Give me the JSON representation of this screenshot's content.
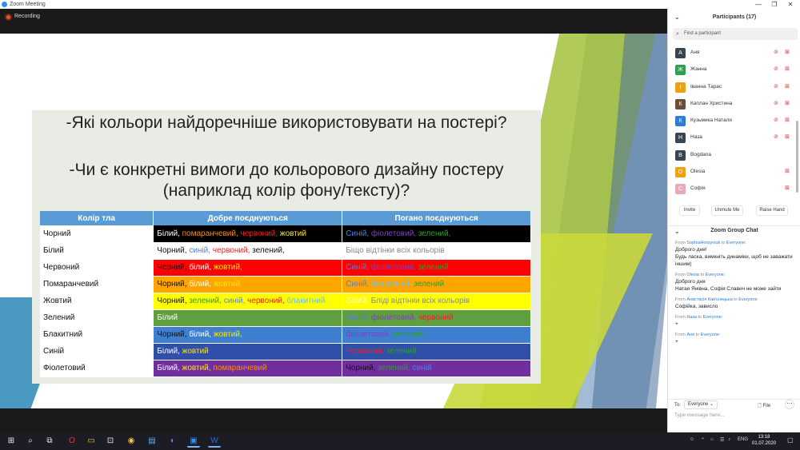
{
  "window": {
    "title": "Zoom Meeting"
  },
  "recording": {
    "label": "Recording"
  },
  "slide": {
    "question1": "-Які кольори найдоречніше використовувати на постері?",
    "question2_line1": "-Чи є конкретні вимоги до кольорового дизайну постеру",
    "question2_line2": "(наприклад колір фону/тексту)?",
    "table": {
      "headers": [
        "Колір тла",
        "Добре поєднуються",
        "Погано поєднуються"
      ],
      "rows": [
        {
          "name": "Чорний",
          "good_bg": "#000000",
          "bad_bg": "#000000",
          "good": [
            [
              "Білий, ",
              "white"
            ],
            [
              "помаранчевий, ",
              "orange"
            ],
            [
              "червоний, ",
              "red"
            ],
            [
              "жовтий",
              "yellow"
            ]
          ],
          "bad": [
            [
              "Синій, ",
              "blue"
            ],
            [
              "фіолетовий, ",
              "violet"
            ],
            [
              "зелений,",
              "green"
            ]
          ]
        },
        {
          "name": "Білий",
          "good_bg": "#ffffff",
          "bad_bg": "#ffffff",
          "good": [
            [
              "Чорний, ",
              "black"
            ],
            [
              "синій, ",
              "blue"
            ],
            [
              "червоний, ",
              "red"
            ],
            [
              "зелений,",
              "black"
            ]
          ],
          "bad": [
            [
              "Біщо відтінки всіх кольорів",
              "pale"
            ]
          ]
        },
        {
          "name": "Червоний",
          "good_bg": "#ff0000",
          "bad_bg": "#ff0000",
          "good": [
            [
              "Чорний, ",
              "black"
            ],
            [
              "білий, ",
              "white"
            ],
            [
              "жовтий,",
              "yellow"
            ]
          ],
          "bad": [
            [
              "Синій, ",
              "blue"
            ],
            [
              "фіолетовий, ",
              "violet"
            ],
            [
              "зелений",
              "green"
            ]
          ]
        },
        {
          "name": "Помаранчевий",
          "good_bg": "#ffa500",
          "bad_bg": "#ffa500",
          "good": [
            [
              "Чорний, ",
              "black"
            ],
            [
              "білий, ",
              "white"
            ],
            [
              "жовтий",
              "yellow"
            ]
          ],
          "bad": [
            [
              "Синій, ",
              "blue"
            ],
            [
              "блакитний, ",
              "lightblue"
            ],
            [
              "зелений",
              "green"
            ]
          ]
        },
        {
          "name": "Жовтий",
          "good_bg": "#ffff00",
          "bad_bg": "#ffff00",
          "good": [
            [
              "Чорний, ",
              "black"
            ],
            [
              "зелений, ",
              "green"
            ],
            [
              "синій, ",
              "blue"
            ],
            [
              "червоний, ",
              "red"
            ],
            [
              "блакитний",
              "lightblue"
            ]
          ],
          "bad": [
            [
              "Білий, ",
              "white"
            ],
            [
              "Бліді відтінки всіх кольорів",
              "pale"
            ]
          ]
        },
        {
          "name": "Зелений",
          "good_bg": "#5f9f3f",
          "bad_bg": "#5f9f3f",
          "good": [
            [
              "Білий",
              "white"
            ]
          ],
          "bad": [
            [
              "Синій, ",
              "blue"
            ],
            [
              "фіолетовий, ",
              "violet"
            ],
            [
              "червоний",
              "red"
            ]
          ]
        },
        {
          "name": "Блакитний",
          "good_bg": "#3f7fd0",
          "bad_bg": "#3f7fd0",
          "good": [
            [
              "Чорний, ",
              "black"
            ],
            [
              "білий, ",
              "white"
            ],
            [
              "жовтий,",
              "yellow"
            ]
          ],
          "bad": [
            [
              "фіолетовий, ",
              "violet"
            ],
            [
              "зелений",
              "green"
            ]
          ]
        },
        {
          "name": "Синій",
          "good_bg": "#2f4fa8",
          "bad_bg": "#2f4fa8",
          "good": [
            [
              "Білий, ",
              "white"
            ],
            [
              "жовтий",
              "yellow"
            ]
          ],
          "bad": [
            [
              "Червоний, ",
              "red"
            ],
            [
              "зелений",
              "green"
            ]
          ]
        },
        {
          "name": "Фіолетовий",
          "good_bg": "#6f2f9f",
          "bad_bg": "#6f2f9f",
          "good": [
            [
              "Білий, ",
              "white"
            ],
            [
              "жовтий, ",
              "yellow"
            ],
            [
              "помаранчевий",
              "orange"
            ]
          ],
          "bad": [
            [
              "Чорний, ",
              "black"
            ],
            [
              "зелений, ",
              "green"
            ],
            [
              "синій",
              "blue"
            ]
          ]
        }
      ]
    }
  },
  "participants": {
    "header": "Participants (17)",
    "search_placeholder": "Find a participant",
    "list": [
      {
        "initial": "А",
        "name": "Аня",
        "color": "#37474f",
        "mic_muted": true,
        "cam_off": true
      },
      {
        "initial": "Ж",
        "name": "Жанна",
        "color": "#2e9e4f",
        "mic_muted": true,
        "cam_off": true
      },
      {
        "initial": "І",
        "name": "Іванна Тарас",
        "color": "#f2a012",
        "mic_muted": true,
        "cam_off": true
      },
      {
        "initial": "К",
        "name": "Каплан Христина",
        "color": "#6b4f3a",
        "mic_muted": true,
        "cam_off": true
      },
      {
        "initial": "К",
        "name": "Кузьмика Наталя",
        "color": "#2d7cd6",
        "mic_muted": true,
        "cam_off": true
      },
      {
        "initial": "Н",
        "name": "Наза",
        "color": "#37474f",
        "mic_muted": true,
        "cam_off": true
      },
      {
        "initial": "B",
        "name": "Bogdana",
        "color": "#37474f",
        "mic_muted": false,
        "cam_off": false
      },
      {
        "initial": "O",
        "name": "Olesia",
        "color": "#f2a012",
        "mic_muted": false,
        "cam_off": true
      },
      {
        "initial": "С",
        "name": "Софія",
        "color": "#e7a9c0",
        "mic_muted": false,
        "cam_off": true
      }
    ],
    "buttons": {
      "invite": "Invite",
      "unmute": "Unmute Me",
      "raise_hand": "Raise Hand"
    }
  },
  "chat": {
    "header": "Zoom Group Chat",
    "messages": [
      {
        "from": "SophiaHorpyniuk",
        "to": "Everyone",
        "lines": [
          "Доброго дня!",
          "Будь ласка, вимкніть динаміки, щоб не заважати іншим)"
        ]
      },
      {
        "from": "Olesia",
        "to": "Everyone",
        "lines": [
          "Доброго дня",
          "Натая Янівна, Софія Славич не може зайти"
        ]
      },
      {
        "from": "Анастасія Кав'єнецька",
        "to": "Everyone",
        "lines": [
          "Софійка, зависло"
        ]
      },
      {
        "from": "Наза",
        "to": "Everyone",
        "lines": [
          "+"
        ]
      },
      {
        "from": "Аня",
        "to": "Everyone",
        "lines": [
          "+"
        ]
      }
    ],
    "from_label": "From",
    "to_word": "to",
    "to_label": "To:",
    "to_value": "Everyone",
    "file_label": "File",
    "input_placeholder": "Type message here..."
  },
  "taskbar": {
    "lang": "ENG",
    "time": "13:18",
    "date": "01.07.2020"
  }
}
